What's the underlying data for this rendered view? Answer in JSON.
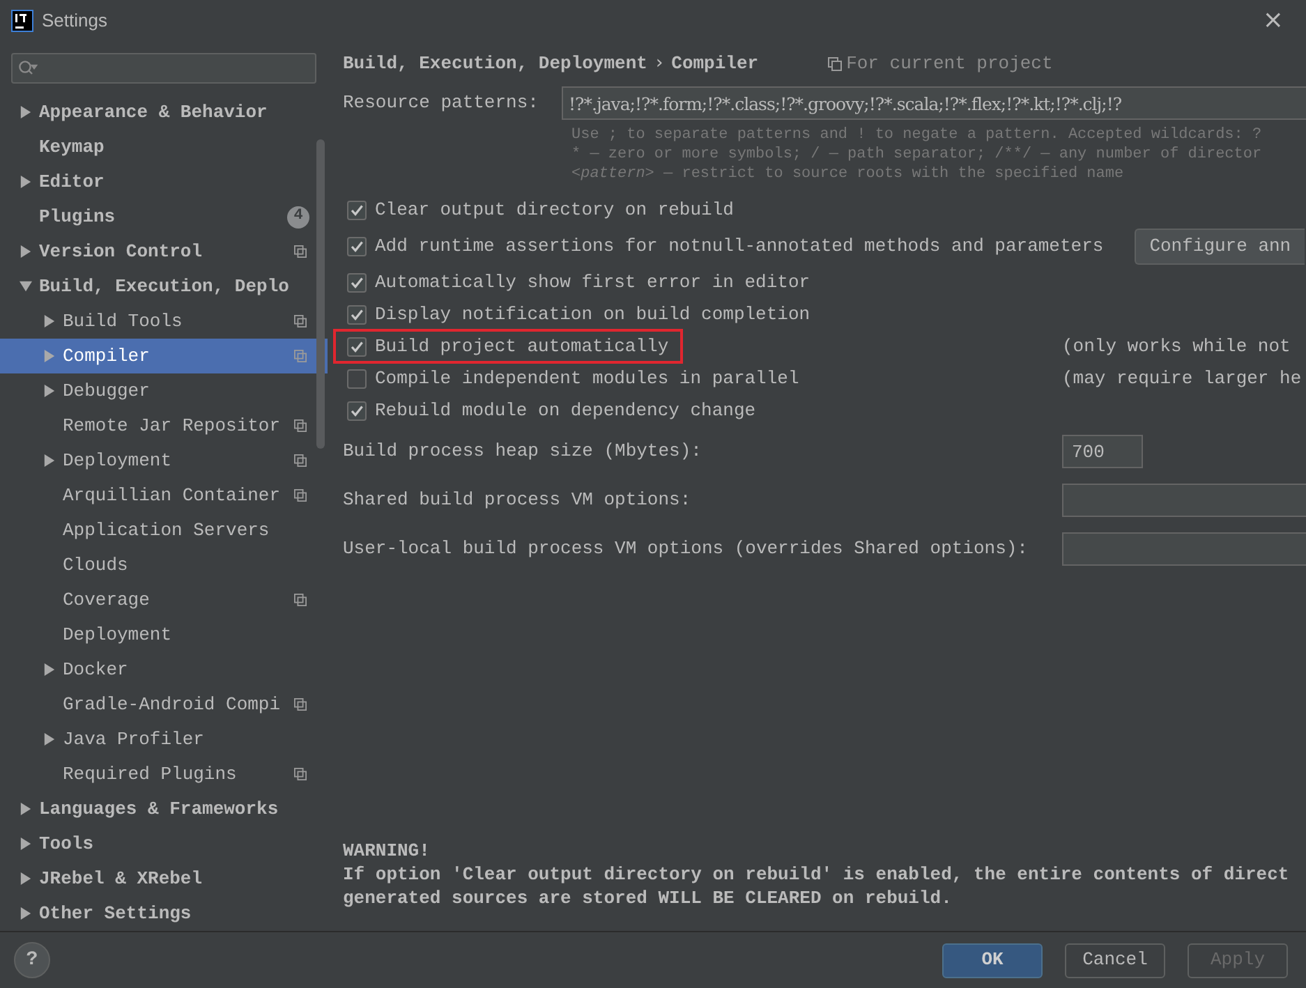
{
  "window": {
    "title": "Settings",
    "close": "×"
  },
  "sidebar": {
    "items": [
      {
        "label": "Appearance & Behavior",
        "expanded": false,
        "selected": false
      },
      {
        "label": "Keymap",
        "selected": false
      },
      {
        "label": "Editor",
        "expanded": false,
        "selected": false
      },
      {
        "label": "Plugins",
        "selected": false,
        "badge": "4"
      },
      {
        "label": "Version Control",
        "expanded": false,
        "selected": false,
        "project_scoped": true
      },
      {
        "label": "Build, Execution, Deplo",
        "expanded": true,
        "selected": false,
        "children": [
          {
            "label": "Build Tools",
            "expanded": false,
            "selected": false,
            "project_scoped": true
          },
          {
            "label": "Compiler",
            "expanded": false,
            "selected": true,
            "project_scoped": true
          },
          {
            "label": "Debugger",
            "expanded": false,
            "selected": false
          },
          {
            "label": "Remote Jar Repositor",
            "selected": false,
            "project_scoped": true
          },
          {
            "label": "Deployment",
            "expanded": false,
            "selected": false,
            "project_scoped": true
          },
          {
            "label": "Arquillian Container",
            "selected": false,
            "project_scoped": true
          },
          {
            "label": "Application Servers",
            "selected": false
          },
          {
            "label": "Clouds",
            "selected": false
          },
          {
            "label": "Coverage",
            "selected": false,
            "project_scoped": true
          },
          {
            "label": "Deployment",
            "selected": false
          },
          {
            "label": "Docker",
            "expanded": false,
            "selected": false
          },
          {
            "label": "Gradle-Android Compi",
            "selected": false,
            "project_scoped": true
          },
          {
            "label": "Java Profiler",
            "expanded": false,
            "selected": false
          },
          {
            "label": "Required Plugins",
            "selected": false,
            "project_scoped": true
          }
        ]
      },
      {
        "label": "Languages & Frameworks",
        "expanded": false,
        "selected": false
      },
      {
        "label": "Tools",
        "expanded": false,
        "selected": false
      },
      {
        "label": "JRebel & XRebel",
        "expanded": false,
        "selected": false
      },
      {
        "label": "Other Settings",
        "expanded": false,
        "selected": false
      }
    ]
  },
  "breadcrumb": {
    "items": [
      "Build, Execution, Deployment",
      "Compiler"
    ],
    "separator": "›",
    "scope_note": "For current project"
  },
  "resource_patterns": {
    "label": "Resource patterns:",
    "value": "!?*.java;!?*.form;!?*.class;!?*.groovy;!?*.scala;!?*.flex;!?*.kt;!?*.clj;!?",
    "hint": [
      "Use ; to separate patterns and ! to negate a pattern. Accepted wildcards: ?",
      "* — zero or more symbols; / — path separator; /**/ — any number of director",
      "*<pattern>* — restrict to source roots with the specified name"
    ]
  },
  "options": [
    {
      "label": "Clear output directory on rebuild",
      "checked": true
    },
    {
      "label": "Add runtime assertions for notnull-annotated methods and parameters",
      "checked": true,
      "button": "Configure ann"
    },
    {
      "label": "Automatically show first error in editor",
      "checked": true
    },
    {
      "label": "Display notification on build completion",
      "checked": true
    },
    {
      "label": "Build project automatically",
      "checked": true,
      "highlighted": true,
      "note": "(only works while not"
    },
    {
      "label": "Compile independent modules in parallel",
      "checked": false,
      "note": "(may require larger he"
    },
    {
      "label": "Rebuild module on dependency change",
      "checked": true
    }
  ],
  "fields": [
    {
      "label": "Build process heap size (Mbytes):",
      "value": "700",
      "kind": "short"
    },
    {
      "label": "Shared build process VM options:",
      "kind": "wide"
    },
    {
      "label": "User-local build process VM options (overrides Shared options):",
      "kind": "wide"
    }
  ],
  "warning": [
    "WARNING!",
    "If option 'Clear output directory on rebuild' is enabled, the entire contents of direct",
    "generated sources are stored WILL BE CLEARED on rebuild."
  ],
  "footer": {
    "help": "?",
    "buttons": [
      {
        "label": "OK",
        "kind": "primary"
      },
      {
        "label": "Cancel",
        "kind": "normal"
      },
      {
        "label": "Apply",
        "kind": "normal",
        "disabled": true
      }
    ]
  }
}
